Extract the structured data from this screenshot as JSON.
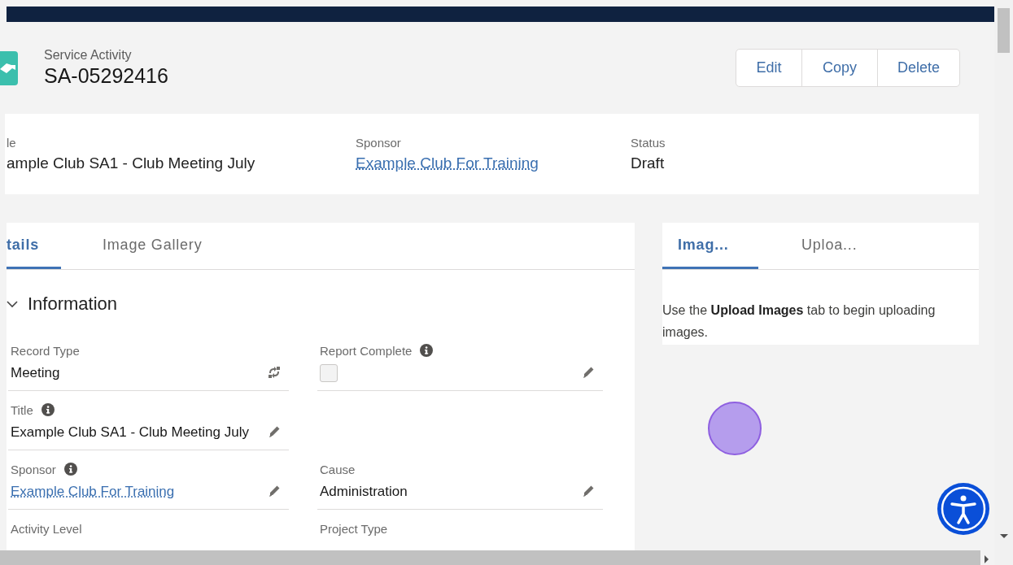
{
  "header": {
    "object_label": "Service Activity",
    "record_name": "SA-05292416",
    "actions": [
      "Edit",
      "Copy",
      "Delete"
    ]
  },
  "highlights": [
    {
      "label": "le",
      "value": "ample Club SA1 - Club Meeting July",
      "kind": "text"
    },
    {
      "label": "Sponsor",
      "value": "Example Club For Training",
      "kind": "link"
    },
    {
      "label": "Status",
      "value": "Draft",
      "kind": "text"
    }
  ],
  "detail_tabs": [
    {
      "label": "tails",
      "selected": true
    },
    {
      "label": "Image Gallery",
      "selected": false
    }
  ],
  "section": {
    "title": "Information",
    "expanded": true
  },
  "field_rows": [
    {
      "left": {
        "label": "Record Type",
        "value": "Meeting",
        "kind": "text",
        "info": false,
        "editable": false,
        "type_changeable": true
      },
      "right": {
        "label": "Report Complete",
        "kind": "checkbox",
        "checked": false,
        "info": true,
        "editable": true
      }
    },
    {
      "left": {
        "label": "Title",
        "value": "Example Club SA1 - Club Meeting July",
        "kind": "text",
        "info": true,
        "editable": true
      }
    },
    {
      "left": {
        "label": "Sponsor",
        "value": "Example Club For Training",
        "kind": "link",
        "info": true,
        "editable": true
      },
      "right": {
        "label": "Cause",
        "value": "Administration",
        "kind": "text",
        "info": false,
        "editable": true
      }
    },
    {
      "left": {
        "label": "Activity Level",
        "kind": "label",
        "info": false
      },
      "right": {
        "label": "Project Type",
        "kind": "label",
        "info": false
      }
    }
  ],
  "side_tabs": [
    {
      "label": "Imag...",
      "selected": true
    },
    {
      "label": "Uploa...",
      "selected": false
    }
  ],
  "side_message": "Use the **Upload Images** tab to begin uploading images."
}
